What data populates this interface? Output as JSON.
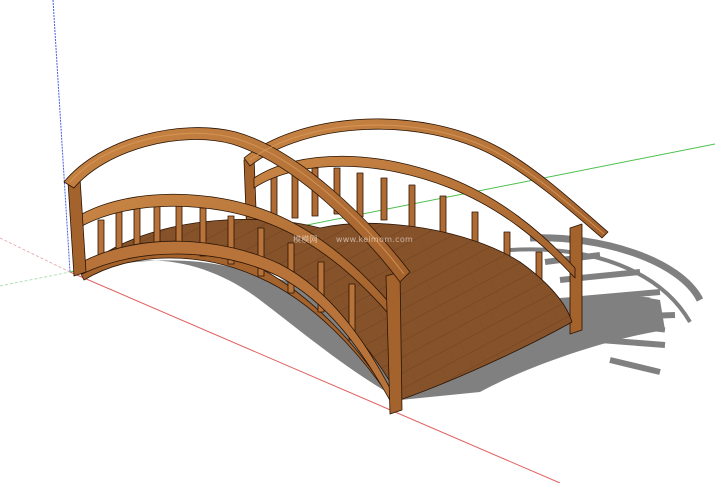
{
  "scene": {
    "subject": "wooden-arched-footbridge",
    "colors": {
      "background": "#ffffff",
      "wood_light": "#c17a3e",
      "wood_mid": "#a4622d",
      "wood_dark": "#6e3d17",
      "deck": "#8a5329",
      "outline": "#2a1505",
      "shadow": "#6b6b6b",
      "axis_red": "#e06060",
      "axis_green": "#4cc04c",
      "axis_blue": "#4a5fe0"
    }
  },
  "watermark": {
    "site_cn": "模模网",
    "url": "www.keimom.com"
  }
}
